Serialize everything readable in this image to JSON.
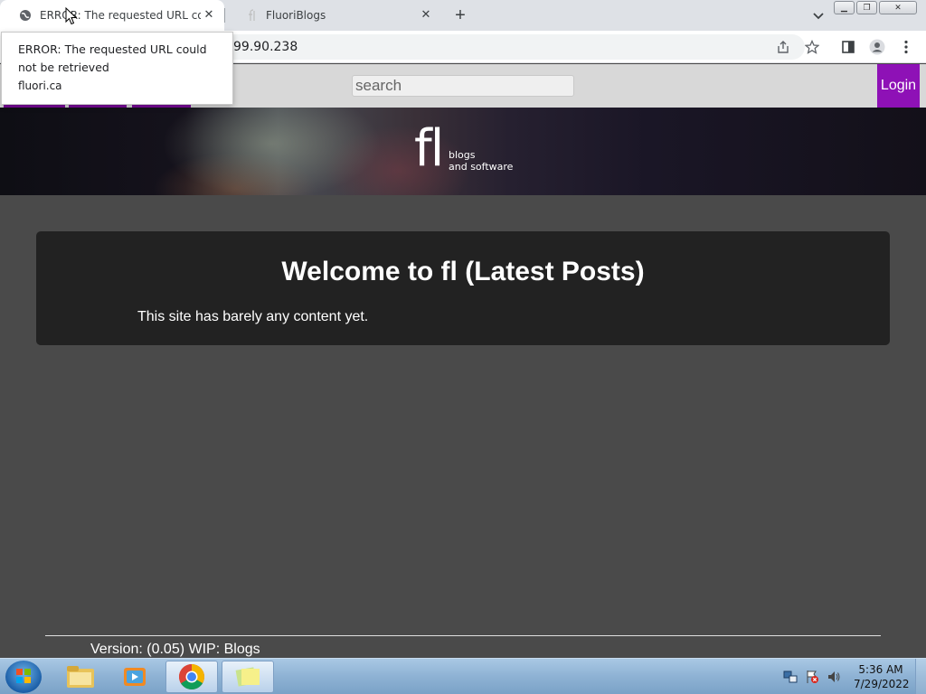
{
  "browser": {
    "tabs": [
      {
        "title": "ERROR: The requested URL could not be retrieved",
        "favicon": "globe-icon",
        "close": "✕"
      },
      {
        "title": "FluoriBlogs",
        "favicon": "fl-favicon-icon",
        "close": "✕"
      }
    ],
    "new_tab": "+",
    "url": "99.90.238",
    "tooltip": {
      "title": "ERROR: The requested URL could not be retrieved",
      "domain": "fluori.ca"
    },
    "window_buttons": {
      "minimize": "▁",
      "maximize": "❐",
      "close": "✕"
    }
  },
  "site": {
    "search_placeholder": "search",
    "login_label": "Login",
    "logo": {
      "mark": "fl",
      "line1": "blogs",
      "line2": "and software"
    },
    "nav_tab_colors": "#7a0a9a"
  },
  "main": {
    "heading": "Welcome to fl (Latest Posts)",
    "body": "This site has barely any content yet."
  },
  "footer": {
    "version": "Version: (0.05) WIP: Blogs"
  },
  "taskbar": {
    "items": [
      "windows-explorer",
      "media-player",
      "chrome",
      "sticky-notes"
    ],
    "clock_time": "5:36 AM",
    "clock_date": "7/29/2022"
  },
  "colors": {
    "accent": "#8e11b6",
    "page_bg": "#4a4a4a",
    "card_bg": "#222222"
  }
}
